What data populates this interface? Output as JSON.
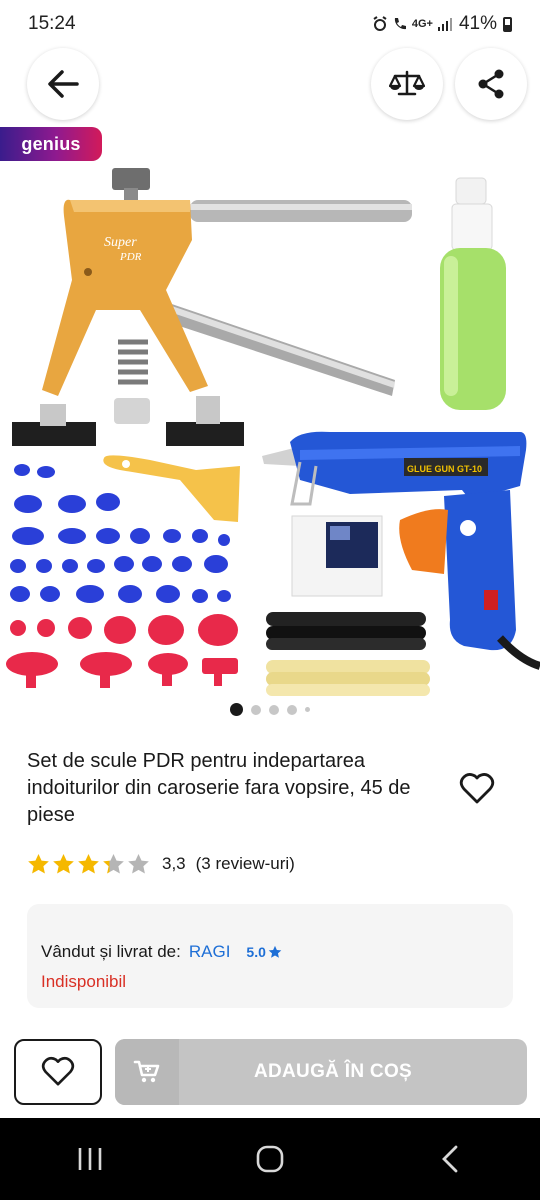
{
  "status_bar": {
    "time": "15:24",
    "network": "4G+",
    "battery": "41%"
  },
  "header": {
    "back_icon": "arrow-left-icon",
    "compare_icon": "scale-icon",
    "share_icon": "share-icon"
  },
  "badge": {
    "label": "genius"
  },
  "gallery": {
    "image_alt": "PDR tool kit: dent lifter, glue gun, glue sticks, tabs, scraper and spray bottle",
    "total_dots": 5,
    "active_index": 0
  },
  "product": {
    "title": "Set de scule PDR pentru indepartarea indoiturilor din caroserie fara vopsire, 45 de piese",
    "rating_value": "3,3",
    "rating_stars": 3.3,
    "review_count": "(3 review-uri)"
  },
  "seller": {
    "label": "Vândut și livrat de:",
    "name": "RAGI",
    "score": "5.0",
    "availability": "Indisponibil"
  },
  "actions": {
    "add_to_cart": "ADAUGĂ ÎN COȘ"
  },
  "colors": {
    "accent_blue": "#1e6fd6",
    "unavailable_red": "#d93025",
    "star_gold": "#f5b800",
    "disabled_button": "#c4c4c4"
  }
}
